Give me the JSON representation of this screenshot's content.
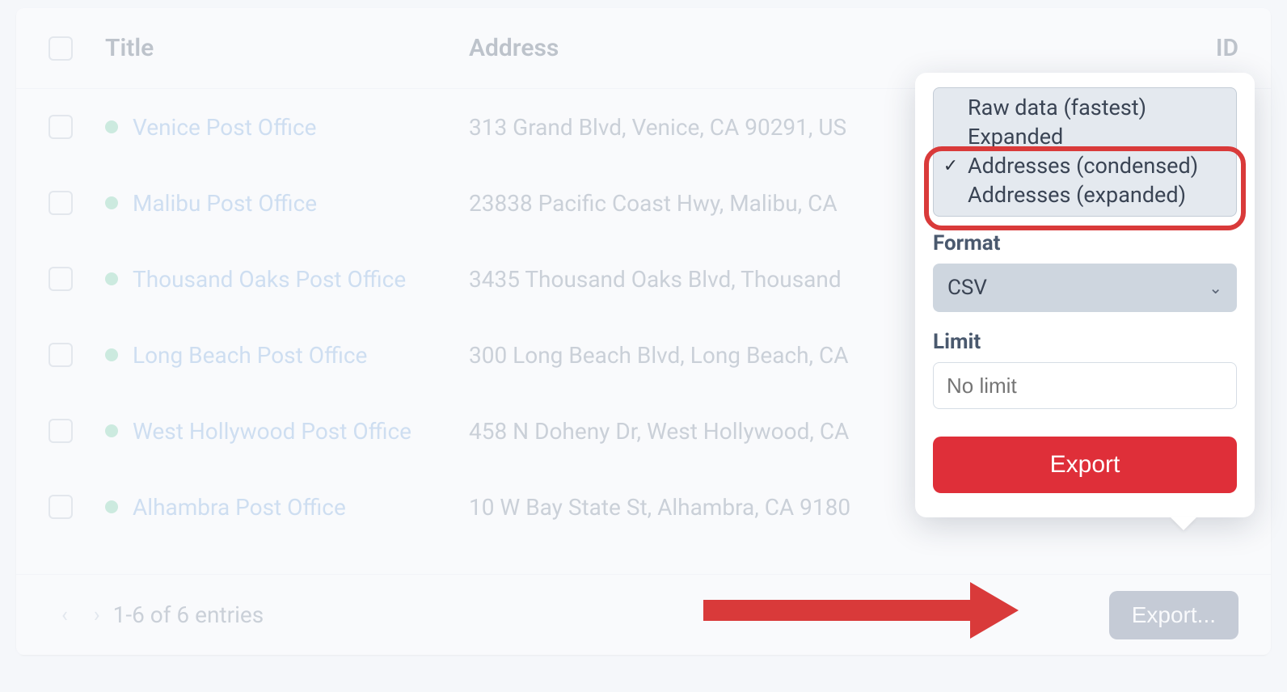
{
  "table": {
    "headers": {
      "title": "Title",
      "address": "Address",
      "id": "ID"
    },
    "rows": [
      {
        "title": "Venice Post Office",
        "address": "313 Grand Blvd, Venice, CA 90291, US"
      },
      {
        "title": "Malibu Post Office",
        "address": "23838 Pacific Coast Hwy, Malibu, CA"
      },
      {
        "title": "Thousand Oaks Post Office",
        "address": "3435 Thousand Oaks Blvd, Thousand"
      },
      {
        "title": "Long Beach Post Office",
        "address": "300 Long Beach Blvd, Long Beach, CA"
      },
      {
        "title": "West Hollywood Post Office",
        "address": "458 N Doheny Dr, West Hollywood, CA"
      },
      {
        "title": "Alhambra Post Office",
        "address": "10 W Bay State St, Alhambra, CA 9180"
      }
    ]
  },
  "footer": {
    "range": "1-6 of 6 entries",
    "export_trigger": "Export..."
  },
  "popover": {
    "options": {
      "raw": "Raw data (fastest)",
      "expanded": "Expanded",
      "addr_condensed": "Addresses (condensed)",
      "addr_expanded": "Addresses (expanded)",
      "selectedIndex": 2
    },
    "format_label": "Format",
    "format_value": "CSV",
    "limit_label": "Limit",
    "limit_placeholder": "No limit",
    "export_button": "Export"
  }
}
